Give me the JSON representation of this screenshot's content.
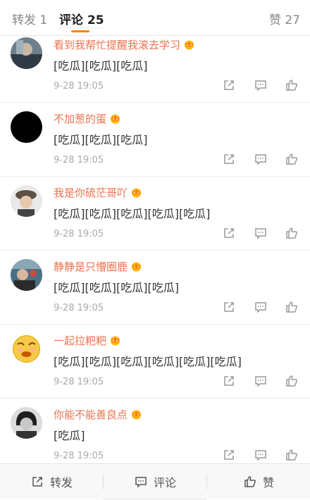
{
  "tabs": {
    "repost": "转发 1",
    "comment": "评论 25",
    "like": "赞 27"
  },
  "comments": [
    {
      "user": "看到我帮忙提醒我滚去学习",
      "text": "[吃瓜][吃瓜][吃瓜]",
      "time": "9-28 19:05"
    },
    {
      "user": "不加葱的蛋",
      "text": "[吃瓜][吃瓜][吃瓜]",
      "time": "9-28 19:05"
    },
    {
      "user": "我是你硫茫哥吖",
      "text": "[吃瓜][吃瓜][吃瓜][吃瓜][吃瓜]",
      "time": "9-28 19:05"
    },
    {
      "user": "静静是只懵圈鹿",
      "text": "[吃瓜][吃瓜][吃瓜][吃瓜]",
      "time": "9-28 19:05"
    },
    {
      "user": "一起拉粑粑",
      "text": "[吃瓜][吃瓜][吃瓜][吃瓜][吃瓜][吃瓜]",
      "time": "9-28 19:05"
    },
    {
      "user": "你能不能善良点",
      "text": "[吃瓜]",
      "time": "9-28 19:05"
    }
  ],
  "toolbar": {
    "repost": "转发",
    "comment": "评论",
    "like": "赞"
  },
  "colors": {
    "accent": "#ff8200",
    "username": "#eb7350"
  },
  "icons": {
    "comment_actions": [
      "share-icon",
      "reply-icon",
      "like-icon"
    ],
    "vip_badge": "vip-crown-badge-icon"
  }
}
